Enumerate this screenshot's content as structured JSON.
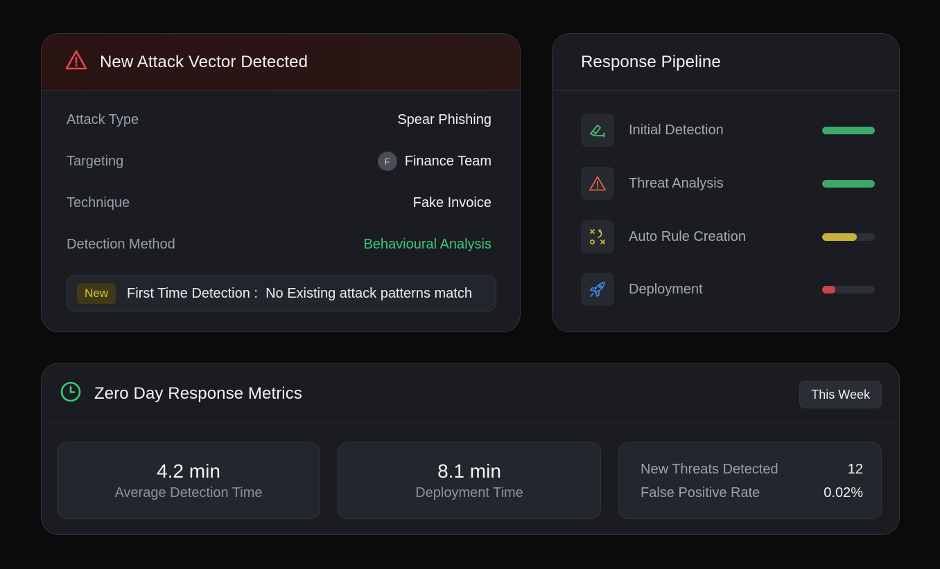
{
  "attack": {
    "title": "New Attack Vector Detected",
    "rows": [
      {
        "label": "Attack Type",
        "value": "Spear Phishing"
      },
      {
        "label": "Targeting",
        "avatar": "F",
        "value": "Finance Team"
      },
      {
        "label": "Technique",
        "value": "Fake Invoice"
      },
      {
        "label": "Detection Method",
        "value": "Behavioural Analysis"
      }
    ],
    "notice": {
      "badge": "New",
      "text": "First Time Detection :  No Existing attack patterns match"
    }
  },
  "pipeline": {
    "title": "Response Pipeline",
    "steps": [
      {
        "label": "Initial Detection",
        "icon": "detection-icon",
        "progress": 1.0,
        "color": "#3da868"
      },
      {
        "label": "Threat Analysis",
        "icon": "warning-icon",
        "progress": 1.0,
        "color": "#3da868"
      },
      {
        "label": "Auto Rule Creation",
        "icon": "strategy-icon",
        "progress": 0.66,
        "color": "#c9b23a"
      },
      {
        "label": "Deployment",
        "icon": "rocket-icon",
        "progress": 0.25,
        "color": "#c7474d"
      }
    ]
  },
  "metrics": {
    "title": "Zero Day Response Metrics",
    "range": "This Week",
    "avg_detection": {
      "value": "4.2 min",
      "label": "Average Detection Time"
    },
    "deployment": {
      "value": "8.1 min",
      "label": "Deployment Time"
    },
    "stats": [
      {
        "label": "New Threats Detected",
        "value": "12"
      },
      {
        "label": "False Positive Rate",
        "value": "0.02%"
      }
    ]
  },
  "colors": {
    "alert_red": "#e5484d",
    "success_green": "#39c977",
    "badge_yellow": "#d9c23d"
  }
}
